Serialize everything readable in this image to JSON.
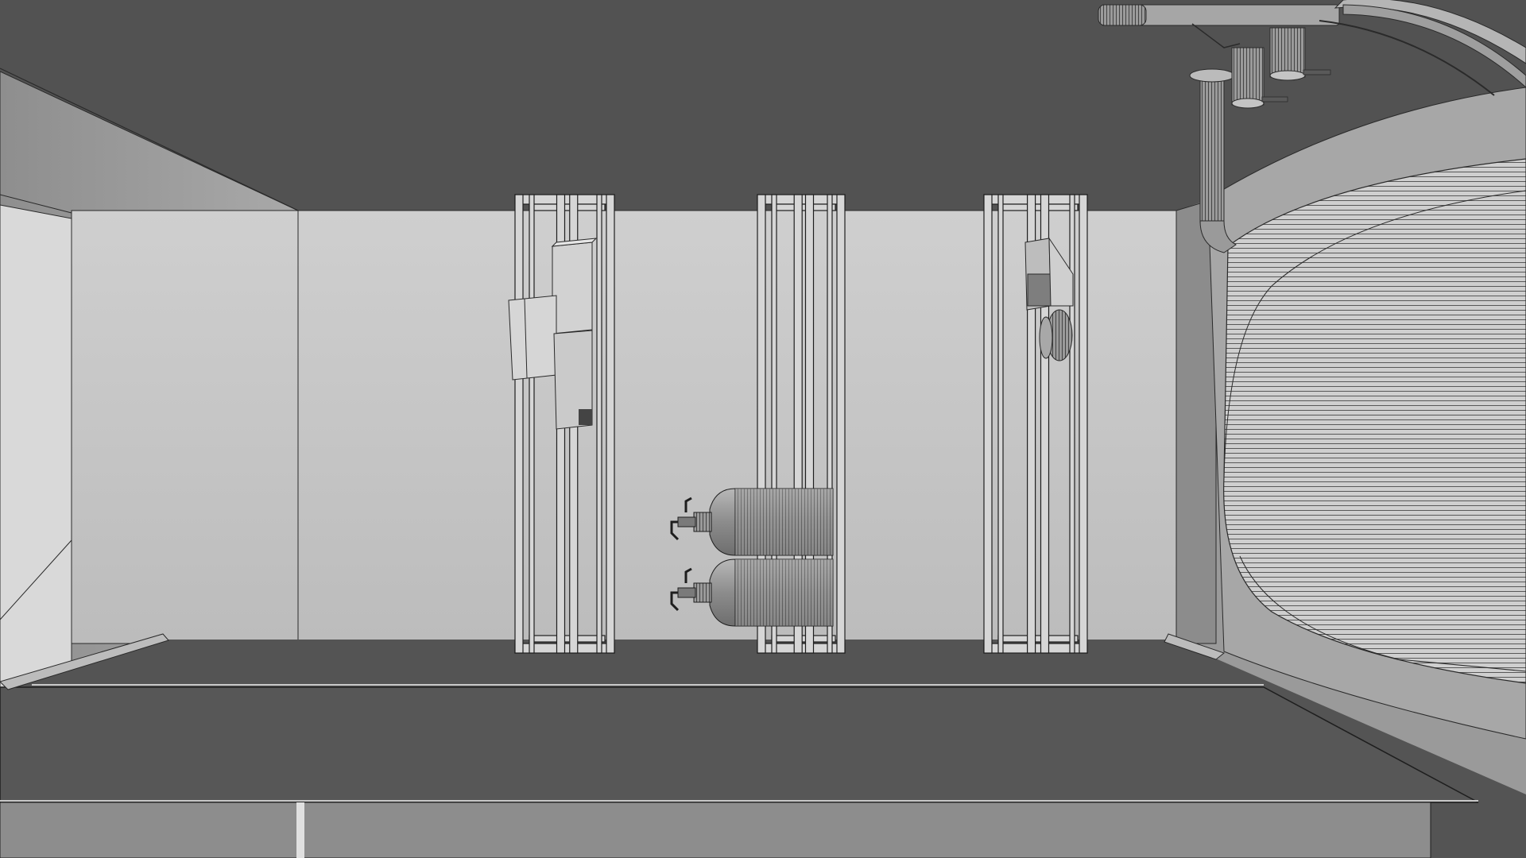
{
  "scene": {
    "description_visible_text": "",
    "colors": {
      "ceiling": "#525252",
      "floor": "#545454",
      "wall_light": "#d8d8d8",
      "wall_mid": "#bdbdbd",
      "wall_dark": "#8a8a8a",
      "line": "#1e1e1e",
      "frame_fill": "#d4d4d4",
      "cylinder_fill": "#9c9c9c",
      "tunnel_inner": "#d0d0d0",
      "tunnel_rim": "#a8a8a8"
    },
    "objects": {
      "racks": 3,
      "gas_cylinders": 2,
      "wall_boxes": 3,
      "ceiling_pipes": 3
    }
  }
}
